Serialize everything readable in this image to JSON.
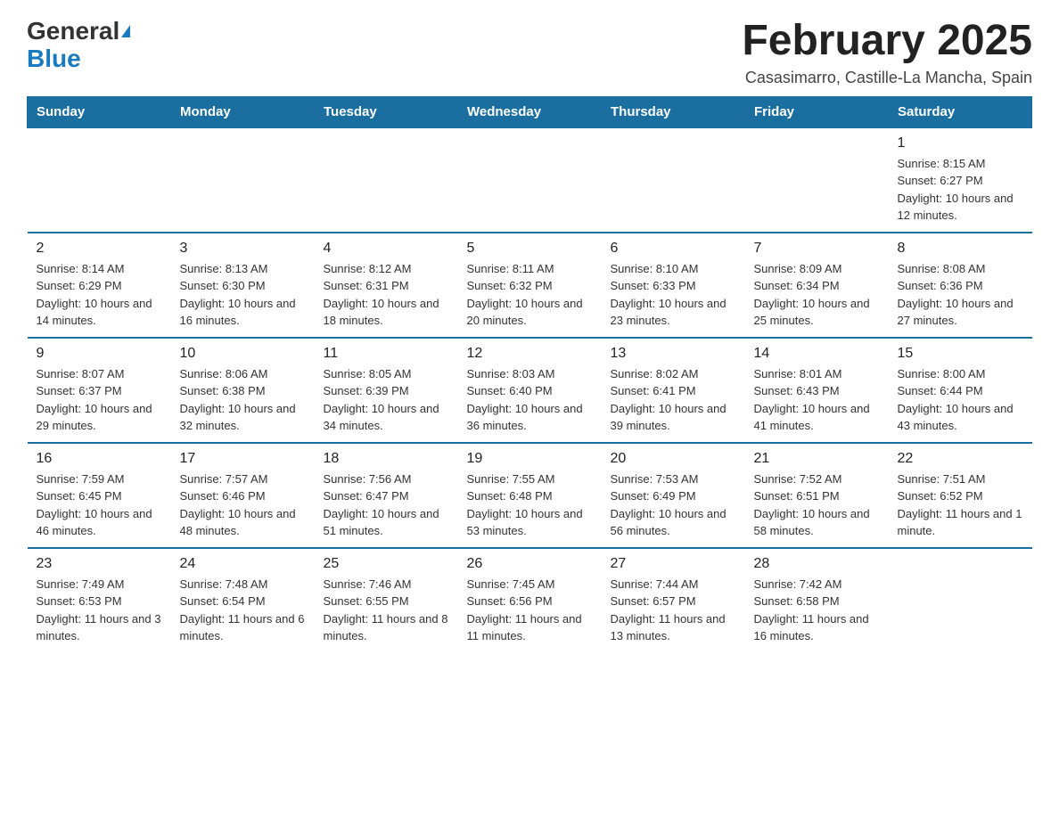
{
  "logo": {
    "general": "General",
    "blue": "Blue"
  },
  "title": "February 2025",
  "subtitle": "Casasimarro, Castille-La Mancha, Spain",
  "weekdays": [
    "Sunday",
    "Monday",
    "Tuesday",
    "Wednesday",
    "Thursday",
    "Friday",
    "Saturday"
  ],
  "weeks": [
    [
      {
        "day": "",
        "info": ""
      },
      {
        "day": "",
        "info": ""
      },
      {
        "day": "",
        "info": ""
      },
      {
        "day": "",
        "info": ""
      },
      {
        "day": "",
        "info": ""
      },
      {
        "day": "",
        "info": ""
      },
      {
        "day": "1",
        "info": "Sunrise: 8:15 AM\nSunset: 6:27 PM\nDaylight: 10 hours and 12 minutes."
      }
    ],
    [
      {
        "day": "2",
        "info": "Sunrise: 8:14 AM\nSunset: 6:29 PM\nDaylight: 10 hours and 14 minutes."
      },
      {
        "day": "3",
        "info": "Sunrise: 8:13 AM\nSunset: 6:30 PM\nDaylight: 10 hours and 16 minutes."
      },
      {
        "day": "4",
        "info": "Sunrise: 8:12 AM\nSunset: 6:31 PM\nDaylight: 10 hours and 18 minutes."
      },
      {
        "day": "5",
        "info": "Sunrise: 8:11 AM\nSunset: 6:32 PM\nDaylight: 10 hours and 20 minutes."
      },
      {
        "day": "6",
        "info": "Sunrise: 8:10 AM\nSunset: 6:33 PM\nDaylight: 10 hours and 23 minutes."
      },
      {
        "day": "7",
        "info": "Sunrise: 8:09 AM\nSunset: 6:34 PM\nDaylight: 10 hours and 25 minutes."
      },
      {
        "day": "8",
        "info": "Sunrise: 8:08 AM\nSunset: 6:36 PM\nDaylight: 10 hours and 27 minutes."
      }
    ],
    [
      {
        "day": "9",
        "info": "Sunrise: 8:07 AM\nSunset: 6:37 PM\nDaylight: 10 hours and 29 minutes."
      },
      {
        "day": "10",
        "info": "Sunrise: 8:06 AM\nSunset: 6:38 PM\nDaylight: 10 hours and 32 minutes."
      },
      {
        "day": "11",
        "info": "Sunrise: 8:05 AM\nSunset: 6:39 PM\nDaylight: 10 hours and 34 minutes."
      },
      {
        "day": "12",
        "info": "Sunrise: 8:03 AM\nSunset: 6:40 PM\nDaylight: 10 hours and 36 minutes."
      },
      {
        "day": "13",
        "info": "Sunrise: 8:02 AM\nSunset: 6:41 PM\nDaylight: 10 hours and 39 minutes."
      },
      {
        "day": "14",
        "info": "Sunrise: 8:01 AM\nSunset: 6:43 PM\nDaylight: 10 hours and 41 minutes."
      },
      {
        "day": "15",
        "info": "Sunrise: 8:00 AM\nSunset: 6:44 PM\nDaylight: 10 hours and 43 minutes."
      }
    ],
    [
      {
        "day": "16",
        "info": "Sunrise: 7:59 AM\nSunset: 6:45 PM\nDaylight: 10 hours and 46 minutes."
      },
      {
        "day": "17",
        "info": "Sunrise: 7:57 AM\nSunset: 6:46 PM\nDaylight: 10 hours and 48 minutes."
      },
      {
        "day": "18",
        "info": "Sunrise: 7:56 AM\nSunset: 6:47 PM\nDaylight: 10 hours and 51 minutes."
      },
      {
        "day": "19",
        "info": "Sunrise: 7:55 AM\nSunset: 6:48 PM\nDaylight: 10 hours and 53 minutes."
      },
      {
        "day": "20",
        "info": "Sunrise: 7:53 AM\nSunset: 6:49 PM\nDaylight: 10 hours and 56 minutes."
      },
      {
        "day": "21",
        "info": "Sunrise: 7:52 AM\nSunset: 6:51 PM\nDaylight: 10 hours and 58 minutes."
      },
      {
        "day": "22",
        "info": "Sunrise: 7:51 AM\nSunset: 6:52 PM\nDaylight: 11 hours and 1 minute."
      }
    ],
    [
      {
        "day": "23",
        "info": "Sunrise: 7:49 AM\nSunset: 6:53 PM\nDaylight: 11 hours and 3 minutes."
      },
      {
        "day": "24",
        "info": "Sunrise: 7:48 AM\nSunset: 6:54 PM\nDaylight: 11 hours and 6 minutes."
      },
      {
        "day": "25",
        "info": "Sunrise: 7:46 AM\nSunset: 6:55 PM\nDaylight: 11 hours and 8 minutes."
      },
      {
        "day": "26",
        "info": "Sunrise: 7:45 AM\nSunset: 6:56 PM\nDaylight: 11 hours and 11 minutes."
      },
      {
        "day": "27",
        "info": "Sunrise: 7:44 AM\nSunset: 6:57 PM\nDaylight: 11 hours and 13 minutes."
      },
      {
        "day": "28",
        "info": "Sunrise: 7:42 AM\nSunset: 6:58 PM\nDaylight: 11 hours and 16 minutes."
      },
      {
        "day": "",
        "info": ""
      }
    ]
  ]
}
